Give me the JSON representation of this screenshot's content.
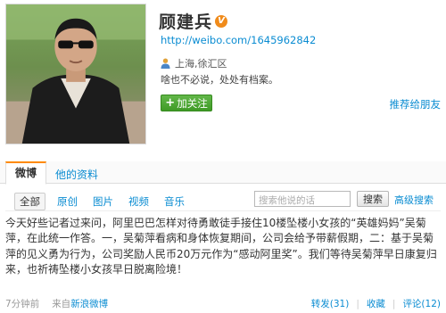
{
  "profile": {
    "name": "顾建兵",
    "url": "http://weibo.com/1645962842",
    "location": "上海,徐汇区",
    "bio": "啥也不必说，处处有档案。",
    "follow_label": "加关注",
    "recommend_label": "推荐给朋友",
    "verified_mark": "V"
  },
  "tabs": {
    "weibo": "微博",
    "profile": "他的资料"
  },
  "filters": {
    "all": "全部",
    "original": "原创",
    "images": "图片",
    "video": "视频",
    "music": "音乐"
  },
  "search": {
    "placeholder": "搜索他说的话",
    "button": "搜索",
    "advanced": "高级搜索"
  },
  "post": {
    "text": "今天好些记者过来问，阿里巴巴怎样对待勇敢徒手接住10楼坠楼小女孩的“英雄妈妈”吴菊萍，在此统一作答。一，吴菊萍看病和身体恢复期间，公司会给予带薪假期，二：基于吴菊萍的见义勇为行为，公司奖励人民币20万元作为“感动阿里奖”。我们等待吴菊萍早日康复归来，也祈祷坠楼小女孩早日脱离险境！",
    "time": "7分钟前",
    "source_prefix": "来自",
    "source": "新浪微博",
    "repost": "转发(31)",
    "favorite": "收藏",
    "comment": "评论(12)"
  },
  "colors": {
    "link": "#0a8cd2",
    "follow_green": "#4aa62f",
    "tab_accent": "#ff8a00",
    "verified": "#f08b1b"
  }
}
